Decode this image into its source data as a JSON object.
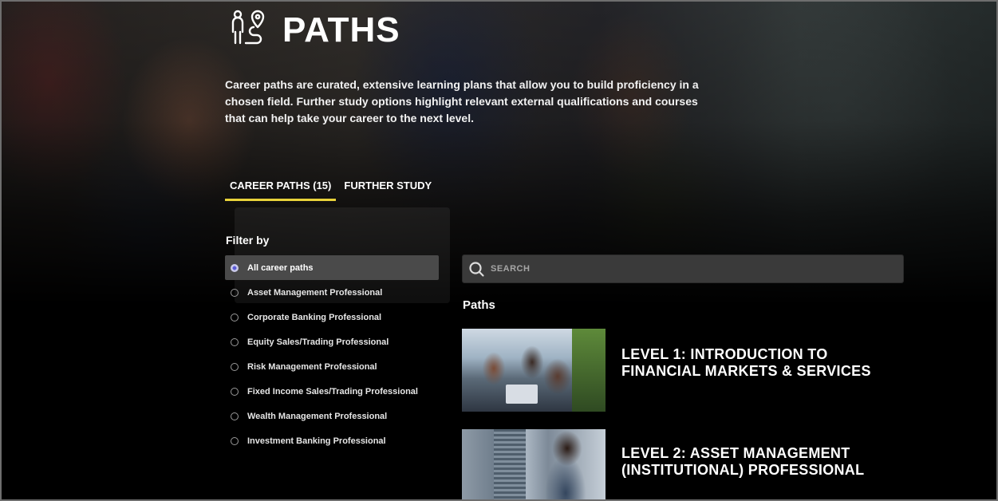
{
  "header": {
    "title": "PATHS",
    "icon": "career-path-icon",
    "intro": "Career paths are curated, extensive learning plans that allow you to build proficiency in a chosen field. Further study options highlight relevant external qualifications and courses that can help take your career to the next level."
  },
  "tabs": [
    {
      "label": "CAREER PATHS (15)",
      "active": true
    },
    {
      "label": "FURTHER STUDY",
      "active": false
    }
  ],
  "filter": {
    "title": "Filter by",
    "options": [
      {
        "label": "All career paths",
        "selected": true
      },
      {
        "label": "Asset Management Professional",
        "selected": false
      },
      {
        "label": "Corporate Banking Professional",
        "selected": false
      },
      {
        "label": "Equity Sales/Trading Professional",
        "selected": false
      },
      {
        "label": "Risk Management Professional",
        "selected": false
      },
      {
        "label": "Fixed Income Sales/Trading Professional",
        "selected": false
      },
      {
        "label": "Wealth Management Professional",
        "selected": false
      },
      {
        "label": "Investment Banking Professional",
        "selected": false
      }
    ]
  },
  "search": {
    "placeholder": "SEARCH",
    "value": ""
  },
  "paths": {
    "heading": "Paths",
    "items": [
      {
        "title": "LEVEL 1: INTRODUCTION TO FINANCIAL MARKETS & SERVICES"
      },
      {
        "title": "LEVEL 2: ASSET MANAGEMENT (INSTITUTIONAL) PROFESSIONAL"
      }
    ]
  },
  "colors": {
    "accent": "#e8d23a",
    "selected_bg": "#4a4a4a",
    "search_bg": "#3a3a3a",
    "radio_selected": "#5b5bd6"
  }
}
